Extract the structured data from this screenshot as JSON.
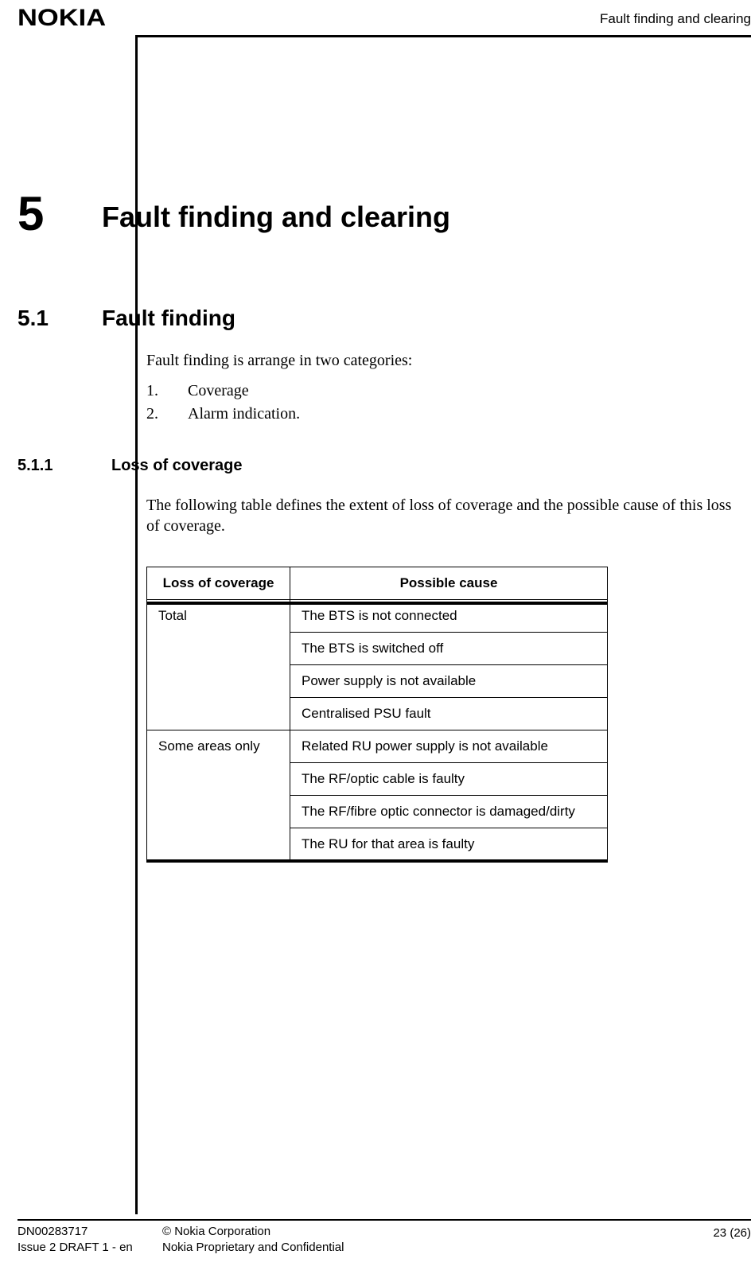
{
  "header": {
    "logo_text": "NOKIA",
    "running_title": "Fault finding and clearing"
  },
  "chapter": {
    "number": "5",
    "title": "Fault finding and clearing"
  },
  "section": {
    "number": "5.1",
    "title": "Fault finding",
    "intro": "Fault finding is arrange in two categories:",
    "list": [
      {
        "n": "1.",
        "t": "Coverage"
      },
      {
        "n": "2.",
        "t": "Alarm indication."
      }
    ]
  },
  "subsection": {
    "number": "5.1.1",
    "title": "Loss of coverage",
    "intro": "The following table defines the extent of loss of coverage and the possible cause of this loss of coverage."
  },
  "table": {
    "headers": {
      "c1": "Loss of coverage",
      "c2": "Possible cause"
    },
    "rows": [
      {
        "loss": "Total",
        "cause": "The BTS is not connected"
      },
      {
        "loss": "",
        "cause": "The BTS is switched off"
      },
      {
        "loss": "",
        "cause": "Power supply is not available"
      },
      {
        "loss": "",
        "cause": "Centralised PSU fault"
      },
      {
        "loss": "Some areas only",
        "cause": "Related RU power supply is not available"
      },
      {
        "loss": "",
        "cause": "The RF/optic cable is faulty"
      },
      {
        "loss": "",
        "cause": "The RF/fibre optic connector is damaged/dirty"
      },
      {
        "loss": "",
        "cause": "The RU for that area is faulty"
      }
    ]
  },
  "footer": {
    "doc_id": "DN00283717",
    "issue": "Issue 2 DRAFT 1 - en",
    "copyright": "© Nokia Corporation",
    "confidential": "Nokia Proprietary and Confidential",
    "page": "23 (26)"
  }
}
